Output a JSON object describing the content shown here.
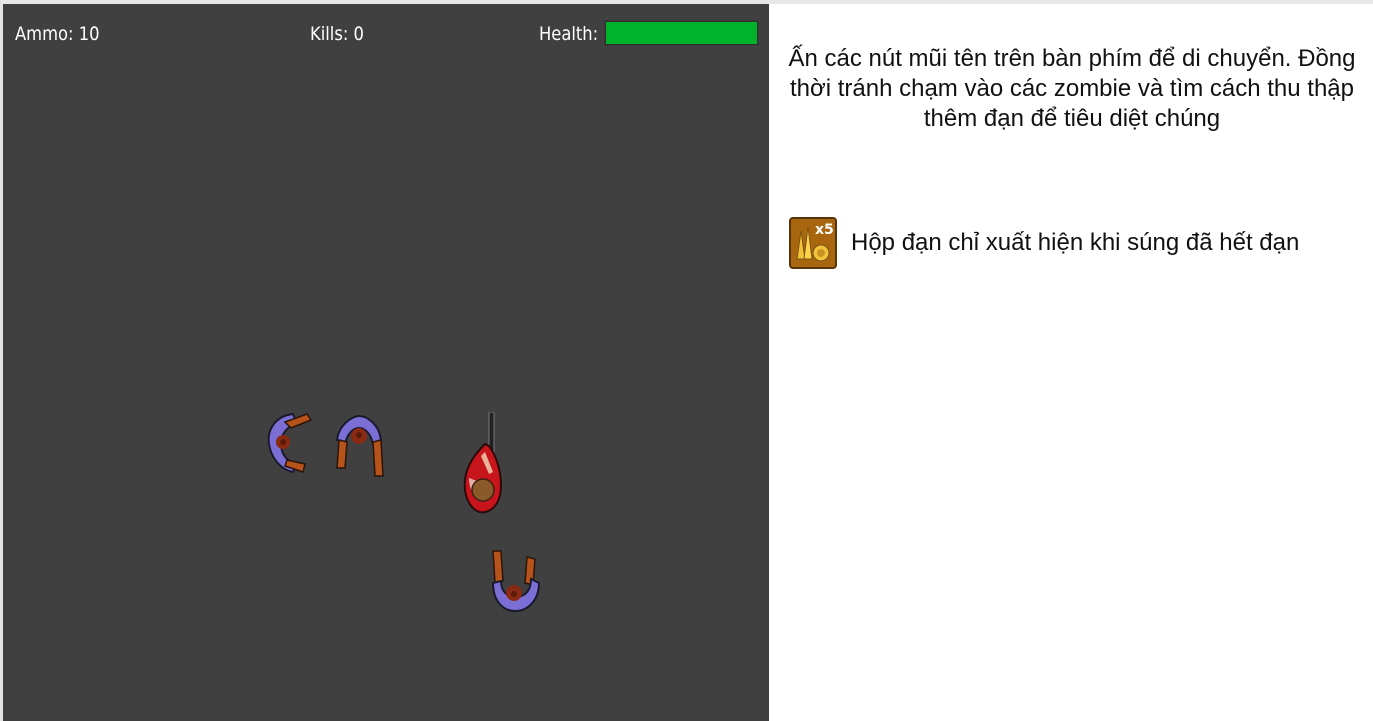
{
  "hud": {
    "ammo_text": "Ammo: 10",
    "kills_text": "Kills: 0",
    "health_label": "Health:",
    "health_fraction": 1.0
  },
  "instructions": {
    "text": "Ấn các nút mũi tên trên bàn phím để di chuyển. Đồng thời tránh chạm vào các zombie và tìm cách thu thập thêm đạn để tiêu diệt chúng"
  },
  "ammo_hint": {
    "text": "Hộp đạn chỉ xuất hiện khi súng đã hết đạn",
    "icon": "ammo-box-icon",
    "icon_label": "x5"
  },
  "colors": {
    "game_background": "#404040",
    "health": "#00b32a",
    "zombie_shirt": "#7b6fd6",
    "zombie_skin": "#b5531a",
    "player_shirt": "#c8151c"
  }
}
